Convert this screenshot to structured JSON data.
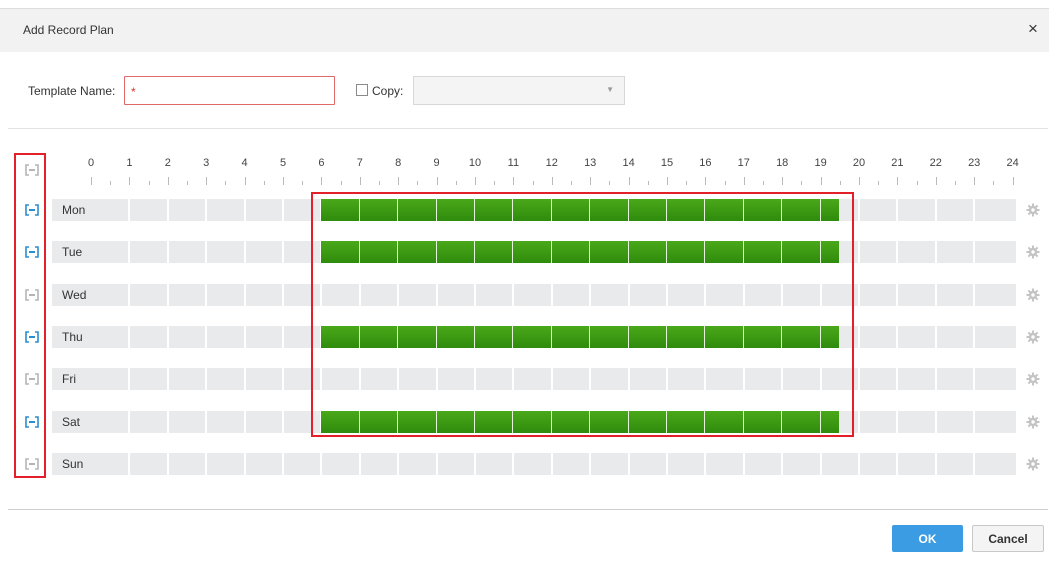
{
  "dialog": {
    "title": "Add Record Plan",
    "close_glyph": "×"
  },
  "form": {
    "template_label": "Template Name:",
    "template_value": "",
    "required_mark": "*",
    "copy_label": "Copy:",
    "copy_checked": false,
    "copy_selected": ""
  },
  "timeline": {
    "hours": [
      "0",
      "1",
      "2",
      "3",
      "4",
      "5",
      "6",
      "7",
      "8",
      "9",
      "10",
      "11",
      "12",
      "13",
      "14",
      "15",
      "16",
      "17",
      "18",
      "19",
      "20",
      "21",
      "22",
      "23",
      "24"
    ]
  },
  "schedule": [
    {
      "day": "Mon",
      "enabled": true,
      "periods": [
        {
          "start": 6,
          "end": 19.5
        }
      ]
    },
    {
      "day": "Tue",
      "enabled": true,
      "periods": [
        {
          "start": 6,
          "end": 19.5
        }
      ]
    },
    {
      "day": "Wed",
      "enabled": false,
      "periods": []
    },
    {
      "day": "Thu",
      "enabled": true,
      "periods": [
        {
          "start": 6,
          "end": 19.5
        }
      ]
    },
    {
      "day": "Fri",
      "enabled": false,
      "periods": []
    },
    {
      "day": "Sat",
      "enabled": true,
      "periods": [
        {
          "start": 6,
          "end": 19.5
        }
      ]
    },
    {
      "day": "Sun",
      "enabled": false,
      "periods": []
    }
  ],
  "colors": {
    "accent": "#3b9ce3",
    "recording": "#3c9a12",
    "highlight": "#e3202a",
    "icon_enabled": "#2a8ed0",
    "icon_disabled": "#b5b5b5"
  },
  "icons": {
    "row_toggle": "link-icon",
    "row_settings": "gear-icon",
    "all_toggle": "link-icon"
  },
  "buttons": {
    "ok": "OK",
    "cancel": "Cancel"
  }
}
